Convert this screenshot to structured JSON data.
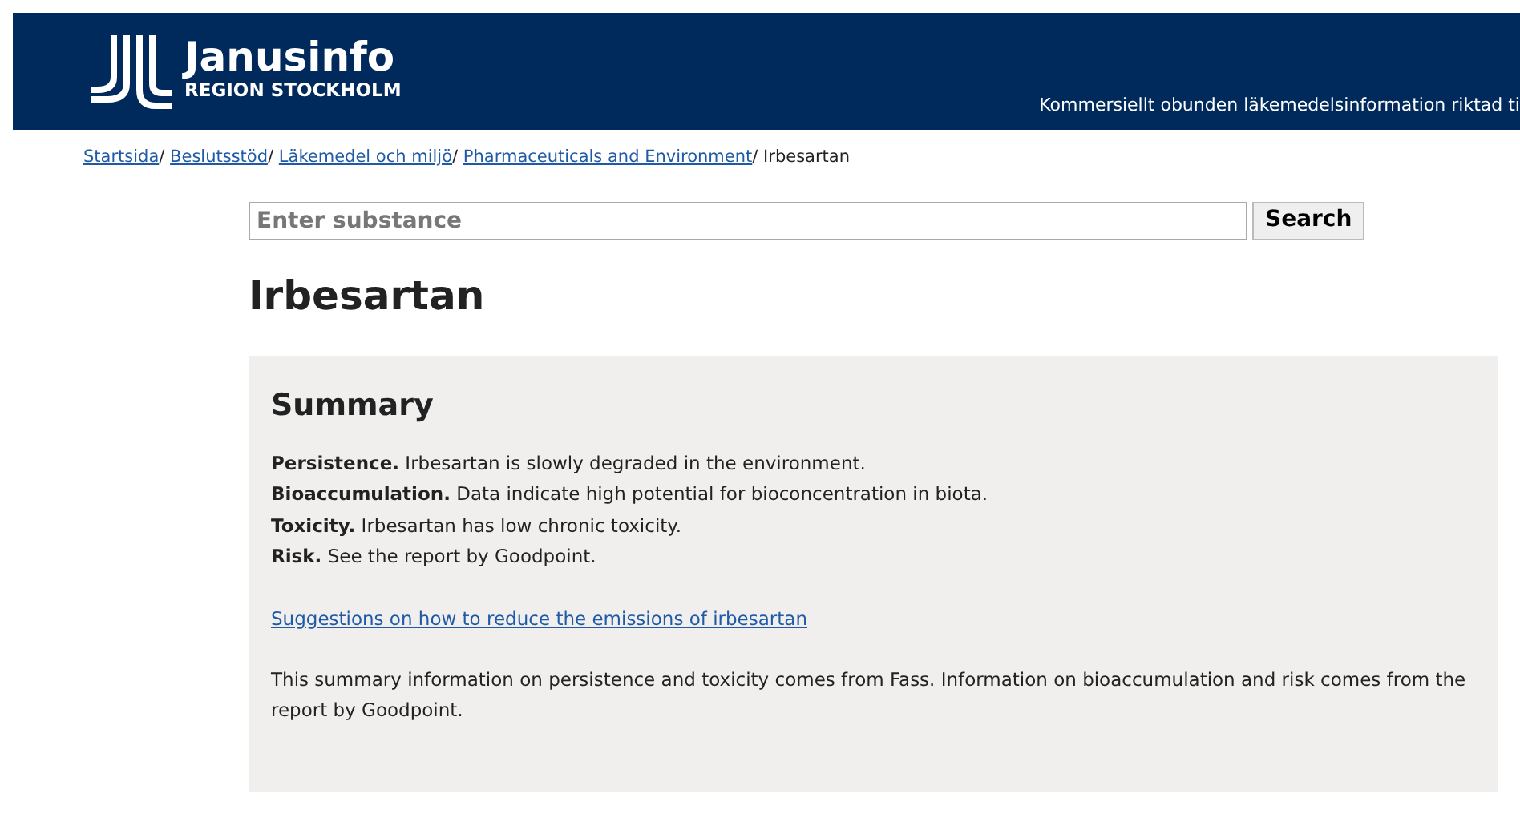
{
  "header": {
    "logo_title": "Janusinfo",
    "logo_subtitle": "REGION STOCKHOLM",
    "tagline": "Kommersiellt obunden läkemedelsinformation riktad ti"
  },
  "breadcrumb": [
    {
      "label": "Startsida",
      "link": true,
      "separator": "/"
    },
    {
      "label": "Beslutsstöd",
      "link": true,
      "separator": "/"
    },
    {
      "label": "Läkemedel och miljö",
      "link": true,
      "separator": "/"
    },
    {
      "label": "Pharmaceuticals and Environment",
      "link": true,
      "separator": "/"
    },
    {
      "label": "Irbesartan",
      "link": false
    }
  ],
  "search": {
    "placeholder": "Enter substance",
    "button": "Search"
  },
  "title": "Irbesartan",
  "summary": {
    "heading": "Summary",
    "lines": [
      "**Persistence.** Irbesartan is slowly degraded in the environment.",
      "**Bioaccumulation.** Data indicate high potential for bioconcentration in biota.",
      "**Toxicity.** Irbesartan has low chronic toxicity.",
      "**Risk.** See the report by Goodpoint."
    ],
    "link": "Suggestions on how to reduce the emissions of irbesartan",
    "note": "This summary information on persistence and toxicity comes from Fass. Information on bioaccumulation and risk comes from the report by Goodpoint."
  }
}
